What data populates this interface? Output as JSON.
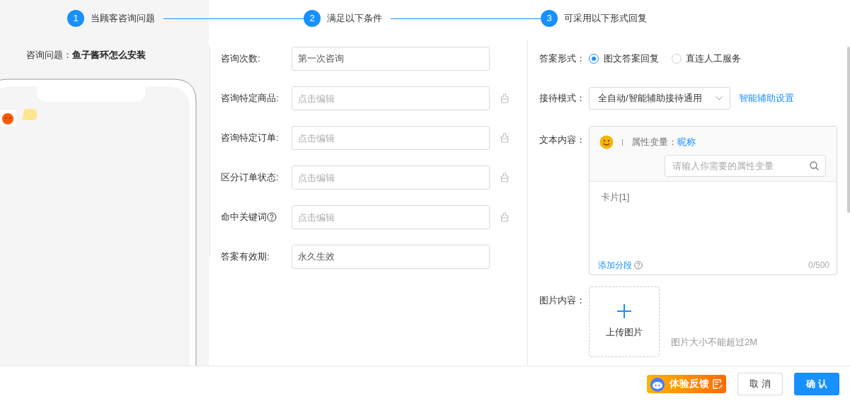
{
  "steps": [
    {
      "number": "1",
      "label": "当顾客咨询问题"
    },
    {
      "number": "2",
      "label": "满足以下条件"
    },
    {
      "number": "3",
      "label": "可采用以下形式回复"
    }
  ],
  "question": {
    "label": "咨询问题：",
    "value": "鱼子酱环怎么安装"
  },
  "conditions": [
    {
      "label": "咨询次数:",
      "value": "第一次咨询",
      "help": false,
      "clearable": false
    },
    {
      "label": "咨询特定商品:",
      "placeholder": "点击编辑",
      "help": false,
      "clearable": true
    },
    {
      "label": "咨询特定订单:",
      "placeholder": "点击编辑",
      "help": false,
      "clearable": true
    },
    {
      "label": "区分订单状态:",
      "placeholder": "点击编辑",
      "help": false,
      "clearable": true
    },
    {
      "label": "命中关键词",
      "placeholder": "点击编辑",
      "help": true,
      "clearable": true
    },
    {
      "label": "答案有效期:",
      "value": "永久生效",
      "help": false,
      "clearable": false
    }
  ],
  "answer_format": {
    "label": "答案形式：",
    "options": [
      {
        "label": "图文答案回复",
        "selected": true
      },
      {
        "label": "直连人工服务",
        "selected": false
      }
    ]
  },
  "reception_mode": {
    "label": "接待模式：",
    "value": "全自动/智能辅助接待通用",
    "link": "智能辅助设置"
  },
  "text_content": {
    "label": "文本内容：",
    "variable_label": "属性变量：",
    "variable": "昵称",
    "search_placeholder": "请输入你需要的属性变量",
    "body_placeholder": "卡片[1]",
    "add_segment": "添加分段",
    "counter": "0/500"
  },
  "image_content": {
    "label": "图片内容：",
    "upload": "上传图片",
    "hint": "图片大小不能超过2M"
  },
  "footer": {
    "feedback": "体验反馈",
    "buttons": [
      {
        "label": "取 消",
        "kind": "secondary"
      },
      {
        "label": "确 认",
        "kind": "primary"
      }
    ]
  }
}
